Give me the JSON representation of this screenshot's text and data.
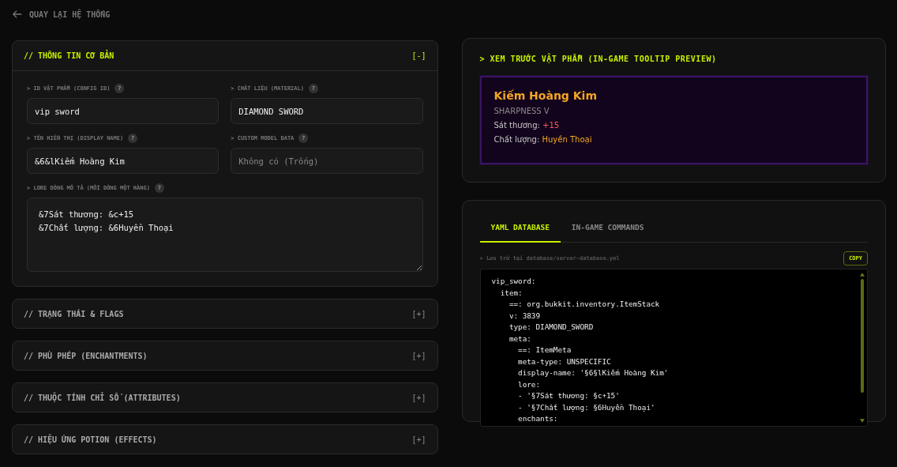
{
  "back_link": {
    "label": "QUAY LẠI HỆ THỐNG"
  },
  "sections": [
    {
      "title": "// THÔNG TIN CƠ BẢN",
      "toggle": "[-]",
      "expanded": true,
      "fields": [
        {
          "label": "> ID VẬT PHẨM (CONFIG ID)",
          "help": "?",
          "value": "vip_sword",
          "kind": "input"
        },
        {
          "label": "> CHẤT LIỆU (MATERIAL)",
          "help": "?",
          "value": "DIAMOND_SWORD",
          "kind": "input"
        },
        {
          "label": "> TÊN HIỂN THỊ (DISPLAY NAME)",
          "help": "?",
          "value": "&6&lKiếm Hoàng Kim",
          "kind": "input"
        },
        {
          "label": "> CUSTOM MODEL DATA",
          "help": "?",
          "placeholder": "Không có (Trống)",
          "kind": "input"
        },
        {
          "label": "> LORE DÒNG MÔ TẢ (MỖI DÒNG MỘT HÀNG)",
          "help": "?",
          "value": "&7Sát thương: &c+15\n&7Chất lượng: &6Huyền Thoại",
          "kind": "textarea"
        }
      ]
    },
    {
      "title": "// TRẠNG THÁI & FLAGS",
      "toggle": "[+]",
      "expanded": false
    },
    {
      "title": "// PHÙ PHÉP (ENCHANTMENTS)",
      "toggle": "[+]",
      "expanded": false
    },
    {
      "title": "// THUỘC TÍNH CHỈ SỐ (ATTRIBUTES)",
      "toggle": "[+]",
      "expanded": false
    },
    {
      "title": "// HIỆU ỨNG POTION (EFFECTS)",
      "toggle": "[+]",
      "expanded": false
    }
  ],
  "preview": {
    "title": "> XEM TRƯỚC VẬT PHẨM (IN-GAME TOOLTIP PREVIEW)",
    "tooltip_lines": [
      {
        "kind": "name",
        "segments": [
          {
            "text": "Kiếm Hoàng Kim",
            "color": "#f5a623"
          }
        ]
      },
      {
        "kind": "lore",
        "segments": [
          {
            "text": "SHARPNESS V",
            "color": "#8a8a8a"
          }
        ]
      },
      {
        "kind": "lore",
        "segments": [
          {
            "text": "Sát thương: ",
            "color": "#c8c8c8"
          },
          {
            "text": "+15",
            "color": "#ff5a5a"
          }
        ]
      },
      {
        "kind": "lore",
        "segments": [
          {
            "text": "Chất lượng: ",
            "color": "#c8c8c8"
          },
          {
            "text": "Huyền Thoại",
            "color": "#f5a623"
          }
        ]
      }
    ]
  },
  "code_panel": {
    "tabs": [
      {
        "label": "YAML DATABASE",
        "selected": true
      },
      {
        "label": "IN-GAME COMMANDS",
        "selected": false
      }
    ],
    "path": "> Lưu trữ tại database/server-database.yml",
    "copy_button": "COPY",
    "lines": [
      "vip_sword:",
      "  item:",
      "    ==: org.bukkit.inventory.ItemStack",
      "    v: 3839",
      "    type: DIAMOND_SWORD",
      "    meta:",
      "      ==: ItemMeta",
      "      meta-type: UNSPECIFIC",
      "      display-name: '§6§lKiếm Hoàng Kim'",
      "      lore:",
      "      - '§7Sát thương: §c+15'",
      "      - '§7Chất lượng: §6Huyền Thoại'",
      "      enchants:"
    ]
  }
}
